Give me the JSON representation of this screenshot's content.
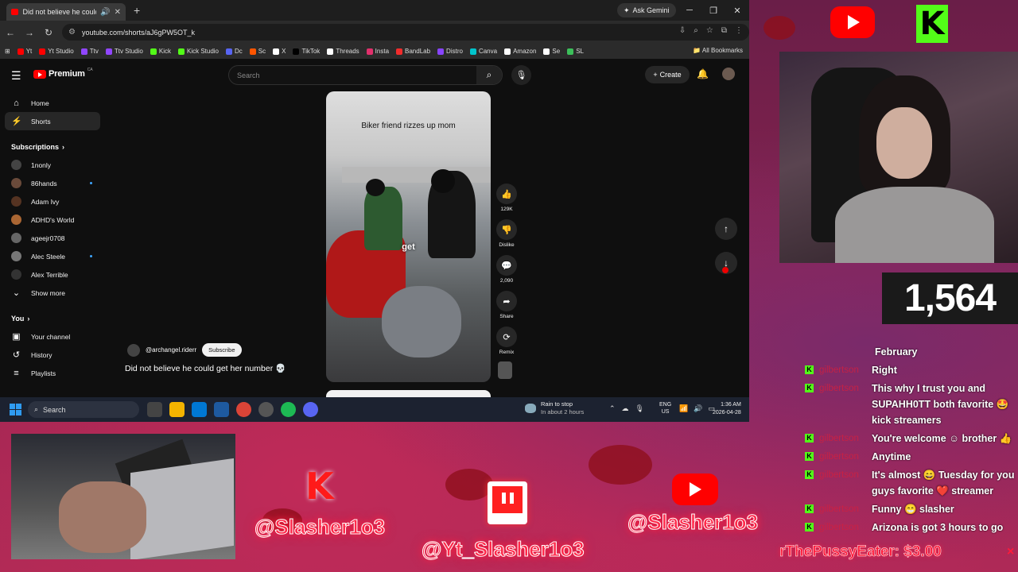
{
  "browser": {
    "tab_title": "Did not believe he could ge",
    "ask_gemini": "Ask Gemini",
    "url": "youtube.com/shorts/aJ6gPW5OT_k",
    "bookmarks": [
      {
        "label": "Yt",
        "color": "#ff0000"
      },
      {
        "label": "Yt Studio",
        "color": "#ff0000"
      },
      {
        "label": "Ttv",
        "color": "#9146ff"
      },
      {
        "label": "Ttv Studio",
        "color": "#9146ff"
      },
      {
        "label": "Kick",
        "color": "#53fc18"
      },
      {
        "label": "Kick Studio",
        "color": "#53fc18"
      },
      {
        "label": "Dc",
        "color": "#5865f2"
      },
      {
        "label": "Sc",
        "color": "#ff5500"
      },
      {
        "label": "X",
        "color": "#ffffff"
      },
      {
        "label": "TikTok",
        "color": "#000000"
      },
      {
        "label": "Threads",
        "color": "#ffffff"
      },
      {
        "label": "Insta",
        "color": "#e1306c"
      },
      {
        "label": "BandLab",
        "color": "#f12c2c"
      },
      {
        "label": "Distro",
        "color": "#8844ff"
      },
      {
        "label": "Canva",
        "color": "#00c4cc"
      },
      {
        "label": "Amazon",
        "color": "#ffffff"
      },
      {
        "label": "Se",
        "color": "#ffffff"
      },
      {
        "label": "SL",
        "color": "#3cbf5a"
      }
    ],
    "all_bookmarks": "All Bookmarks"
  },
  "youtube": {
    "logo_text": "Premium",
    "logo_region": "CA",
    "search_placeholder": "Search",
    "create_label": "Create",
    "sidebar": {
      "main": [
        {
          "label": "Home",
          "icon": "home-icon"
        },
        {
          "label": "Shorts",
          "icon": "shorts-icon"
        }
      ],
      "subscriptions_heading": "Subscriptions",
      "subscriptions": [
        {
          "label": "1nonly",
          "color": "#444",
          "dot": false
        },
        {
          "label": "86hands",
          "color": "#6a4a3a",
          "dot": true
        },
        {
          "label": "Adam Ivy",
          "color": "#553322",
          "dot": false
        },
        {
          "label": "ADHD's World",
          "color": "#aa6633",
          "dot": false
        },
        {
          "label": "ageejr0708",
          "color": "#666",
          "dot": false
        },
        {
          "label": "Alec Steele",
          "color": "#777",
          "dot": true
        },
        {
          "label": "Alex Terrible",
          "color": "#333",
          "dot": false
        }
      ],
      "show_more": "Show more",
      "you_heading": "You",
      "you": [
        {
          "label": "Your channel",
          "icon": "user-icon"
        },
        {
          "label": "History",
          "icon": "history-icon"
        },
        {
          "label": "Playlists",
          "icon": "playlists-icon"
        }
      ]
    },
    "short": {
      "caption": "Biker friend rizzes up mom",
      "subtitle_word": "get",
      "likes": "129K",
      "dislike": "Dislike",
      "comments": "2,090",
      "share": "Share",
      "remix": "Remix",
      "channel": "@archangel.riderr",
      "subscribe": "Subscribe",
      "title": "Did not believe he could get her number 💀"
    }
  },
  "taskbar": {
    "search": "Search",
    "weather_title": "Rain to stop",
    "weather_sub": "In about 2 hours",
    "lang1": "ENG",
    "lang2": "US",
    "time": "1:36 AM",
    "date": "2026-04-28"
  },
  "stream": {
    "follower_count": "1,564",
    "handle_kick": "@Slasher1o3",
    "handle_twitch": "@Yt_Slasher1o3",
    "handle_youtube": "@Slasher1o3",
    "chat": [
      {
        "user": "",
        "text": "February"
      },
      {
        "user": "gilbertson",
        "text": "Right"
      },
      {
        "user": "gilbertson",
        "text": "This why I trust you and SUPAHH0TT both favorite 🤩 kick streamers"
      },
      {
        "user": "gilbertson",
        "text": "You're welcome ☺ brother 👍"
      },
      {
        "user": "gilbertson",
        "text": "Anytime"
      },
      {
        "user": "gilbertson",
        "text": "It's almost 😄 Tuesday for you guys favorite ❤️ streamer"
      },
      {
        "user": "gilbertson",
        "text": "Funny 😁 slasher"
      },
      {
        "user": "gilbertson",
        "text": "Arizona is got 3 hours to go"
      }
    ],
    "ticker": "rThePussyEater: $3.00"
  }
}
